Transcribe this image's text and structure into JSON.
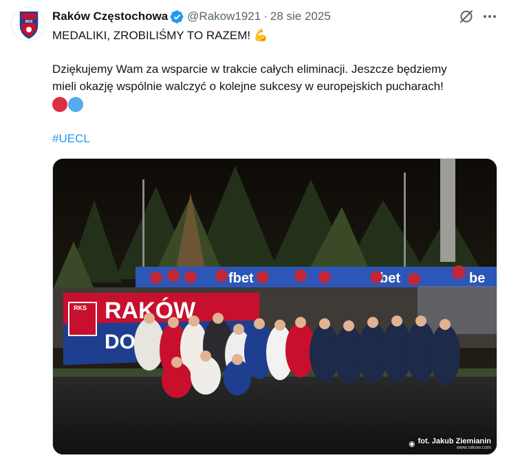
{
  "author": {
    "name": "Raków Częstochowa",
    "handle": "@Rakow1921",
    "separator": "·",
    "date": "28 sie 2025",
    "avatar_text": "RKS"
  },
  "tweet": {
    "line1": "MEDALIKI, ZROBILIŚMY TO RAZEM! 💪",
    "line2": "Dziękujemy Wam za wsparcie w trakcie całych eliminacji. Jeszcze będziemy",
    "line3": "mieli okazję wspólnie walczyć o kolejne sukcesy w europejskich pucharach!",
    "emoji_dots": [
      "red-circle",
      "blue-circle"
    ],
    "hashtag": "#UECL"
  },
  "media": {
    "photo_credit": "fot. Jakub Ziemianin",
    "photo_credit_site": "www.rakow.com",
    "banner_text_left": "RKS",
    "banner_text_flag": "RAKÓW",
    "banner_text_flag_lower": "DO",
    "ad_board_text": "fbet",
    "ad_board_text_right": "bet",
    "ad_board_text_far": "be"
  },
  "colors": {
    "accent": "#1d9bf0",
    "verified": "#1d9bf0",
    "red_dot": "#dd2e44",
    "blue_dot": "#55acee",
    "club_red": "#c8102e",
    "club_blue": "#1e3f8f"
  },
  "icons": {
    "verified": "verified-badge-icon",
    "grok": "grok-icon",
    "more": "more-icon"
  }
}
